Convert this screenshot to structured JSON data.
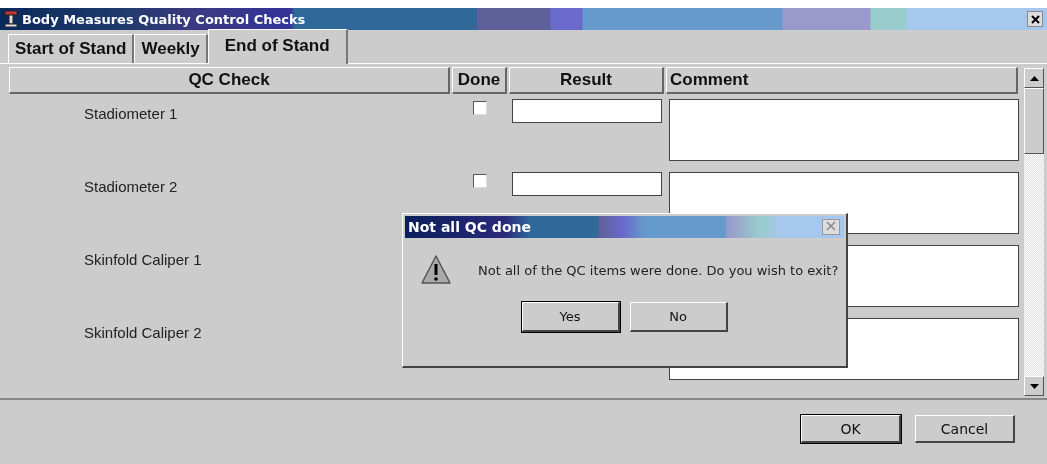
{
  "window": {
    "title": "Body Measures Quality Control Checks"
  },
  "tabs": [
    {
      "label": "Start of Stand",
      "selected": false
    },
    {
      "label": "Weekly",
      "selected": false
    },
    {
      "label": "End of Stand",
      "selected": true
    }
  ],
  "table": {
    "columns": [
      "QC Check",
      "Done",
      "Result",
      "Comment"
    ],
    "rows": [
      {
        "check": "Stadiometer 1",
        "done": false
      },
      {
        "check": "Stadiometer 2",
        "done": false
      },
      {
        "check": "Skinfold Caliper 1"
      },
      {
        "check": "Skinfold Caliper 2"
      }
    ]
  },
  "buttons": [
    "OK",
    "Cancel"
  ],
  "dialog": {
    "title": "Not all QC done",
    "message": "Not all of the QC items were done. Do you wish to exit?",
    "buttons": [
      "Yes",
      "No"
    ]
  }
}
